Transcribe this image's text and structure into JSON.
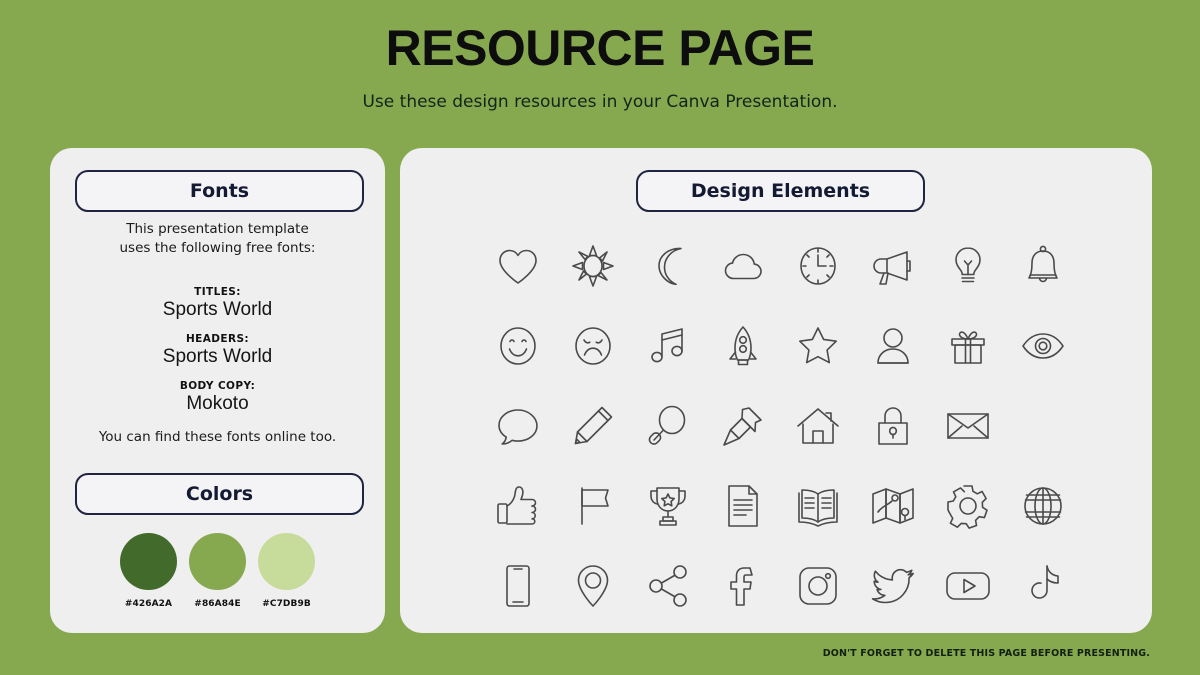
{
  "header": {
    "title": "RESOURCE PAGE",
    "subtitle": "Use these design resources in your Canva Presentation."
  },
  "background_color": "#86A84E",
  "card_color": "#EFEFEF",
  "accent_border_color": "#1F2440",
  "fonts_panel": {
    "pill_label": "Fonts",
    "intro": "This presentation template\nuses the following free fonts:",
    "groups": [
      {
        "label": "TITLES:",
        "value": "Sports World"
      },
      {
        "label": "HEADERS:",
        "value": "Sports World"
      },
      {
        "label": "BODY COPY:",
        "value": "Mokoto"
      }
    ],
    "outro": "You can find these fonts online too."
  },
  "colors_panel": {
    "pill_label": "Colors",
    "swatches": [
      {
        "hex": "#426A2A",
        "label": "#426A2A"
      },
      {
        "hex": "#86A84E",
        "label": "#86A84E"
      },
      {
        "hex": "#C7DB9B",
        "label": "#C7DB9B"
      }
    ]
  },
  "elements_panel": {
    "pill_label": "Design Elements",
    "rows": [
      [
        "heart-icon",
        "sun-icon",
        "moon-icon",
        "cloud-icon",
        "clock-icon",
        "megaphone-icon",
        "lightbulb-icon",
        "bell-icon"
      ],
      [
        "smiley-face-icon",
        "sad-face-icon",
        "music-note-icon",
        "rocket-icon",
        "star-icon",
        "person-icon",
        "gift-icon",
        "eye-icon"
      ],
      [
        "speech-bubble-icon",
        "pencil-icon",
        "magnifier-icon",
        "pushpin-icon",
        "house-icon",
        "lock-icon",
        "envelope-icon"
      ],
      [
        "thumbs-up-icon",
        "flag-icon",
        "trophy-icon",
        "document-icon",
        "book-icon",
        "map-icon",
        "gear-icon",
        "globe-icon"
      ],
      [
        "phone-icon",
        "location-pin-icon",
        "share-icon",
        "facebook-icon",
        "instagram-icon",
        "twitter-icon",
        "youtube-icon",
        "tiktok-icon"
      ]
    ]
  },
  "footer": {
    "note": "DON'T FORGET TO DELETE THIS PAGE BEFORE PRESENTING."
  }
}
